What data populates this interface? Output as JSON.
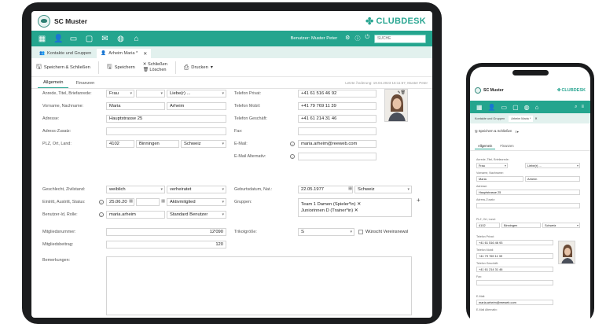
{
  "tablet": {
    "club_name": "SC Muster",
    "brand": "CLUBDESK",
    "nav": {
      "user": "Benutzer: Muster Peter",
      "search_placeholder": "SUCHE"
    },
    "tabs": [
      {
        "label": "Kontakte und Gruppen"
      },
      {
        "label": "Arheim Maria *"
      }
    ],
    "toolbar": {
      "save_close": "Speichern & Schließen",
      "save": "Speichern",
      "close": "Schließen",
      "delete": "Löschen",
      "print": "Drucken"
    },
    "subtabs": [
      "Allgemein",
      "Finanzen"
    ],
    "last_change": "Letzte Änderung: 19.04.2023 16:11:57, Muster Peter",
    "labels": {
      "salutation": "Anrede, Titel, Briefanrede:",
      "name": "Vorname, Nachname:",
      "address": "Adresse:",
      "address_extra": "Adress-Zusatz:",
      "zip_city_country": "PLZ, Ort, Land:",
      "phone_private": "Telefon Privat:",
      "phone_mobile": "Telefon Mobil:",
      "phone_business": "Telefon Geschäft:",
      "fax": "Fax:",
      "email": "E-Mail:",
      "email_alt": "E-Mail Alternativ:",
      "gender_civil": "Geschlecht, Zivilstand:",
      "entry_exit_status": "Eintritt, Austritt, Status:",
      "user_role": "Benutzer-Id, Rolle:",
      "birthdate_nat": "Geburtsdatum, Nat.:",
      "groups": "Gruppen:",
      "member_no": "Mitgliedsnummer:",
      "member_fee": "Mitgliedsbeitrag:",
      "shirt_size": "Trikotgröße:",
      "remarks": "Bemerkungen:"
    },
    "values": {
      "salutation": "Frau",
      "title": "",
      "letter_salutation": "Liebe(r) ...",
      "first_name": "Maria",
      "last_name": "Arheim",
      "address": "Hauptstrasse 25",
      "address_extra": "",
      "zip": "4102",
      "city": "Binningen",
      "country": "Schweiz",
      "phone_private": "+41 61 516 46 92",
      "phone_mobile": "+41 79 769 11 39",
      "phone_business": "+41 61 214 31 46",
      "fax": "",
      "email": "maria.arheim@reeweb.com",
      "email_alt": "",
      "gender": "weiblich",
      "civil_status": "verheiratet",
      "entry_date": "25.06.20",
      "exit_date": "",
      "status": "Aktivmitglied",
      "user_id": "maria.arheim",
      "role": "Standard Benutzer",
      "birthdate": "22.05.1977",
      "nationality": "Schweiz",
      "group_1": "Team 1 Damen (Spieler*in)",
      "group_2": "Juniorinnen D (Trainer*in)",
      "member_no": "12'090",
      "member_fee": "120",
      "shirt_size": "S",
      "newsletter_wish": "Wünscht Vereinsnewsl"
    }
  },
  "phone": {
    "club_name": "SC Muster",
    "brand": "CLUBDESK",
    "tabs": [
      "Kontakte und Gruppen",
      "Arheim Maria *"
    ],
    "save_close": "Speichern & Schließen",
    "subtabs": [
      "Allgemein",
      "Finanzen"
    ],
    "labels": {
      "salutation": "Anrede, Titel, Briefanrede:",
      "name": "Vorname, Nachname:",
      "address": "Adresse:",
      "address_extra": "Adress-Zusatz:",
      "zip_city_country": "PLZ, Ort, Land:",
      "phone_private": "Telefon Privat:",
      "phone_mobile": "Telefon Mobil:",
      "phone_business": "Telefon Geschäft:",
      "fax": "Fax:",
      "email": "E-Mail:",
      "email_alt": "E-Mail Alternativ:"
    },
    "values": {
      "salutation": "Frau",
      "letter_salutation": "Liebe(r) ...",
      "first_name": "Maria",
      "last_name": "Arheim",
      "address": "Hauptstrasse 25",
      "zip": "4102",
      "city": "Binningen",
      "country": "Schweiz",
      "phone_private": "+41 61 516 46 93",
      "phone_mobile": "+41 79 769 11 39",
      "phone_business": "+41 61 214 31 46",
      "email": "maria.arheim@reeweb.com"
    }
  },
  "colors": {
    "accent": "#24a58e",
    "brand": "#2aa692",
    "tab_bar": "#e2f1ee"
  }
}
